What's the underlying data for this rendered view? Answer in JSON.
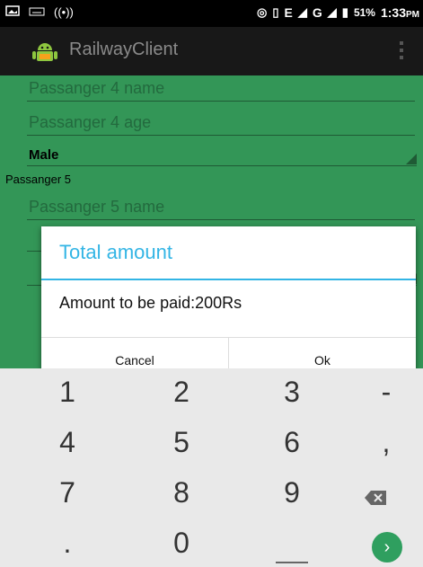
{
  "statusbar": {
    "network_text": "E",
    "network_text2": "G",
    "battery": "51%",
    "time": "1:33",
    "ampm": "PM"
  },
  "app": {
    "title": "RailwayClient"
  },
  "form": {
    "p4_name_placeholder": "Passanger 4 name",
    "p4_age_placeholder": "Passanger 4 age",
    "p4_gender": "Male",
    "p5_label": "Passanger 5",
    "p5_name_placeholder": "Passanger 5 name"
  },
  "dialog": {
    "title": "Total amount",
    "message": "Amount to be paid:200Rs",
    "cancel": "Cancel",
    "ok": "Ok"
  },
  "keyboard": {
    "row1": [
      "1",
      "2",
      "3",
      "-"
    ],
    "row2": [
      "4",
      "5",
      "6",
      ","
    ],
    "row3": [
      "7",
      "8",
      "9"
    ],
    "row4": [
      ".",
      "0"
    ]
  },
  "colors": {
    "accent": "#33b5e5",
    "form_bg": "#339657",
    "keyboard_bg": "#e9e9e9"
  }
}
